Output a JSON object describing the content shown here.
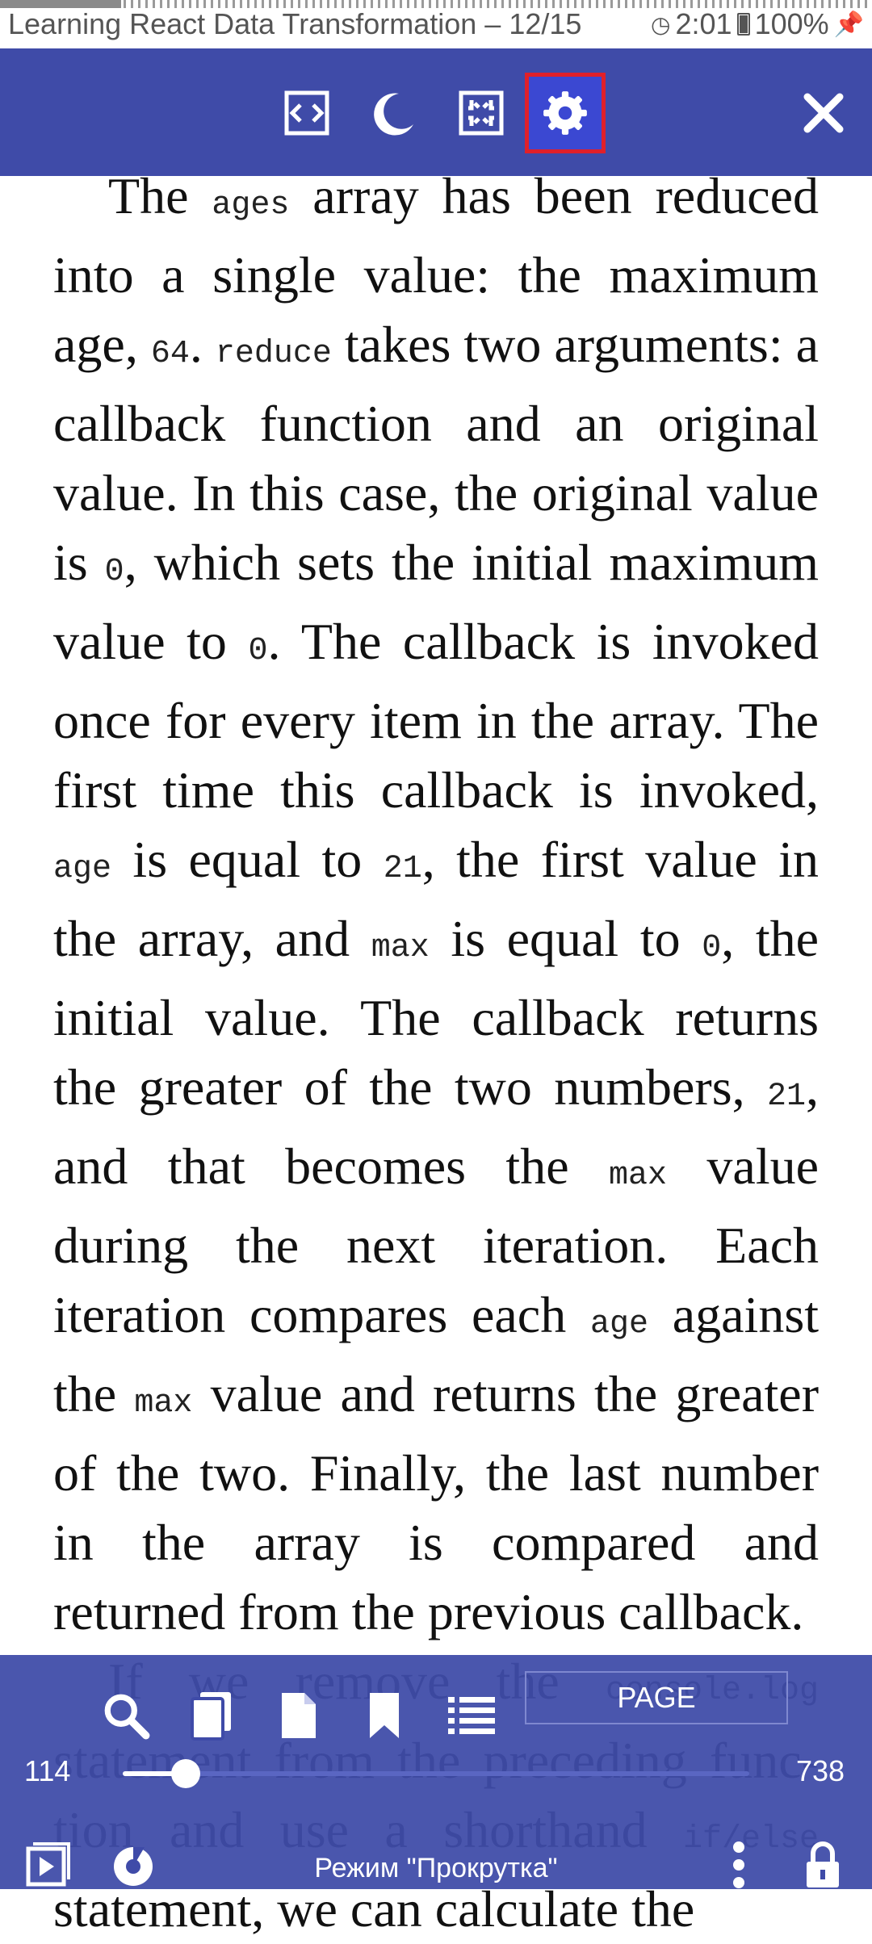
{
  "status_bar": {
    "title": "Learning React  Data Transformation – 12/15",
    "time": "2:01",
    "battery": "100%",
    "icons": [
      "clock-icon",
      "battery-icon",
      "pin-icon"
    ]
  },
  "toolbar": {
    "buttons": [
      {
        "icon": "fit-width-icon",
        "selected": false
      },
      {
        "icon": "night-mode-icon",
        "selected": false
      },
      {
        "icon": "fullscreen-icon",
        "selected": false
      },
      {
        "icon": "settings-gear-icon",
        "selected": true
      }
    ],
    "close_icon": "close-icon",
    "colors": {
      "bar": "#3f4ba8",
      "selected_bg": "#3b48d2",
      "selected_border": "#e0202a"
    }
  },
  "reading": {
    "p1": [
      {
        "t": "text",
        "v": "The "
      },
      {
        "t": "code",
        "v": "ages"
      },
      {
        "t": "text",
        "v": " array has been reduced into a single value: the maximum age, "
      },
      {
        "t": "code",
        "v": "64"
      },
      {
        "t": "text",
        "v": ". "
      },
      {
        "t": "code",
        "v": "reduce"
      },
      {
        "t": "text",
        "v": " takes two argu­ments: a callback function and an original value. In this case, the original value is "
      },
      {
        "t": "code",
        "v": "0"
      },
      {
        "t": "text",
        "v": ", which sets the initial maximum value to "
      },
      {
        "t": "code",
        "v": "0"
      },
      {
        "t": "text",
        "v": ". The callback is invoked once for every item in the array. The first time this callback is invoked, "
      },
      {
        "t": "code",
        "v": "age"
      },
      {
        "t": "text",
        "v": " is equal to "
      },
      {
        "t": "code",
        "v": "21"
      },
      {
        "t": "text",
        "v": ", the first value in the array, and "
      },
      {
        "t": "code",
        "v": "max"
      },
      {
        "t": "text",
        "v": " is equal to "
      },
      {
        "t": "code",
        "v": "0"
      },
      {
        "t": "text",
        "v": ", the initial value. The callback returns the greater of the two numbers, "
      },
      {
        "t": "code",
        "v": "21"
      },
      {
        "t": "text",
        "v": ", and that be­comes the "
      },
      {
        "t": "code",
        "v": "max"
      },
      {
        "t": "text",
        "v": " value during the next iteration. Each iteration com­pares each "
      },
      {
        "t": "code",
        "v": "age"
      },
      {
        "t": "text",
        "v": " against the "
      },
      {
        "t": "code",
        "v": "max"
      },
      {
        "t": "text",
        "v": " value and returns the greater of the two. Finally, the last number in the array is compared and returned from the previous callback."
      }
    ],
    "p2": [
      {
        "t": "text",
        "v": "If we remove the "
      },
      {
        "t": "code",
        "v": "console.log"
      },
      {
        "t": "text",
        "v": " statement from the preceding func­tion and use a shorthand "
      },
      {
        "t": "code",
        "v": "if/else"
      },
      {
        "t": "text",
        "v": " statement, we can calculate the"
      }
    ]
  },
  "bottom_panel": {
    "icons": [
      "search-icon",
      "pages-icon",
      "page-icon",
      "bookmark-icon",
      "contents-list-icon"
    ],
    "page_button_label": "PAGE",
    "current_page": "114",
    "total_pages": "738",
    "slider_progress": 0.1,
    "mode_label": "Режим \"Прокрутка\"",
    "row_icons": [
      "autoscroll-icon",
      "speed-icon",
      "more-vert-icon",
      "lock-icon"
    ]
  }
}
